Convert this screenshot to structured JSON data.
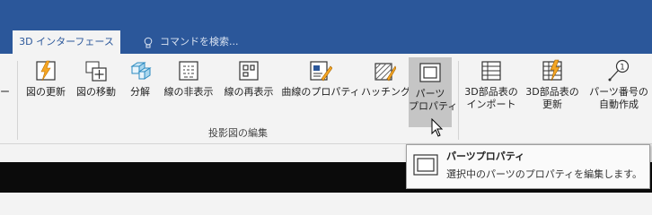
{
  "ribbon_tabs": {
    "active": "3D インターフェース",
    "tell_me_placeholder": "コマンドを検索..."
  },
  "ribbon": {
    "left_partial": "ー",
    "buttons": [
      {
        "label": "図の更新"
      },
      {
        "label": "図の移動"
      },
      {
        "label": "分解"
      },
      {
        "label": "線の非表示"
      },
      {
        "label": "線の再表示"
      },
      {
        "label": "曲線のプロパティ"
      },
      {
        "label": "ハッチング"
      },
      {
        "label_line1": "パーツ",
        "label_line2": "プロパティ"
      },
      {
        "label_line1": "3D部品表の",
        "label_line2": "インポート"
      },
      {
        "label_line1": "3D部品表の",
        "label_line2": "更新"
      },
      {
        "label_line1": "パーツ番号の",
        "label_line2": "自動作成"
      }
    ],
    "group_label": "投影図の編集"
  },
  "tooltip": {
    "title": "パーツプロパティ",
    "description": "選択中のパーツのプロパティを編集します。"
  },
  "colors": {
    "brand_blue": "#2b579a",
    "ribbon_bg": "#f3f3f3",
    "hover_bg": "#c5c5c5",
    "accent_orange": "#f5a623"
  }
}
